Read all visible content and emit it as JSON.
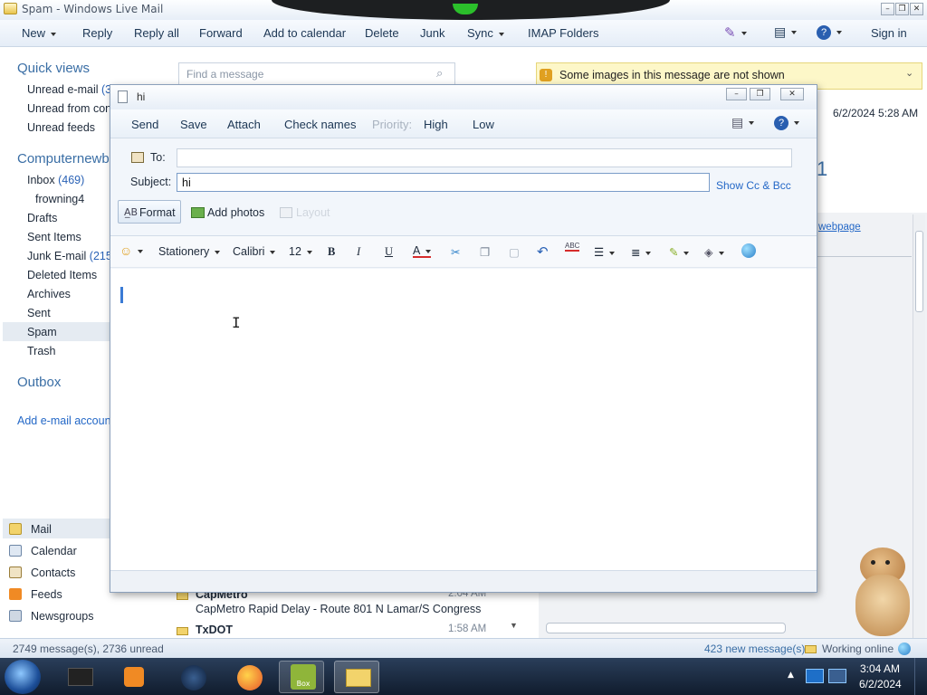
{
  "window": {
    "title": "Spam - Windows Live Mail"
  },
  "menu": {
    "items": [
      "New",
      "Reply",
      "Reply all",
      "Forward",
      "Add to calendar",
      "Delete",
      "Junk",
      "Sync",
      "IMAP Folders"
    ],
    "signin": "Sign in"
  },
  "left": {
    "quick_views": "Quick views",
    "qv_items": [
      {
        "label": "Unread e-mail",
        "count": "(3"
      },
      {
        "label": "Unread from con",
        "count": ""
      },
      {
        "label": "Unread feeds",
        "count": ""
      }
    ],
    "account": "Computernewb",
    "folders": [
      {
        "label": "Inbox",
        "count": "(469)"
      },
      {
        "label": "frowning4",
        "count": ""
      },
      {
        "label": "Drafts",
        "count": ""
      },
      {
        "label": "Sent Items",
        "count": ""
      },
      {
        "label": "Junk E-mail",
        "count": "(215"
      },
      {
        "label": "Deleted Items",
        "count": ""
      },
      {
        "label": "Archives",
        "count": ""
      },
      {
        "label": "Sent",
        "count": ""
      },
      {
        "label": "Spam",
        "count": ""
      },
      {
        "label": "Trash",
        "count": ""
      }
    ],
    "outbox": "Outbox",
    "add_account": "Add e-mail account"
  },
  "nav": {
    "items": [
      "Mail",
      "Calendar",
      "Contacts",
      "Feeds",
      "Newsgroups"
    ]
  },
  "search": {
    "placeholder": "Find a message"
  },
  "reading": {
    "info": "Some images in this message are not shown",
    "date": "6/2/2024 5:28 AM",
    "big": "1",
    "webpage": "webpage"
  },
  "messages": [
    {
      "sender": "CapMetro",
      "time": "2:04 AM",
      "subject": "CapMetro Rapid Delay - Route 801 N Lamar/S Congress"
    },
    {
      "sender": "TxDOT",
      "time": "1:58 AM",
      "subject": ""
    }
  ],
  "compose": {
    "title": "hi",
    "toolbar": [
      "Send",
      "Save",
      "Attach",
      "Check names"
    ],
    "priority_label": "Priority:",
    "priority_high": "High",
    "priority_low": "Low",
    "to_label": "To:",
    "to_value": "",
    "subject_label": "Subject:",
    "subject_value": "hi",
    "show_cc": "Show Cc & Bcc",
    "format": "Format",
    "add_photos": "Add photos",
    "layout": "Layout",
    "stationery": "Stationery",
    "font": "Calibri",
    "size": "12",
    "bold": "B",
    "italic": "I",
    "underline": "U",
    "font_color": "A",
    "spell": "ABC"
  },
  "status": {
    "left": "2749 message(s), 2736 unread",
    "new": "423 new message(s)",
    "online": "Working online"
  },
  "taskbar": {
    "time": "3:04 AM",
    "date": "6/2/2024",
    "box": "Box"
  },
  "colors": {
    "accent": "#3a6ea5",
    "link": "#2468c7",
    "info_bg": "#fdf7c8"
  }
}
